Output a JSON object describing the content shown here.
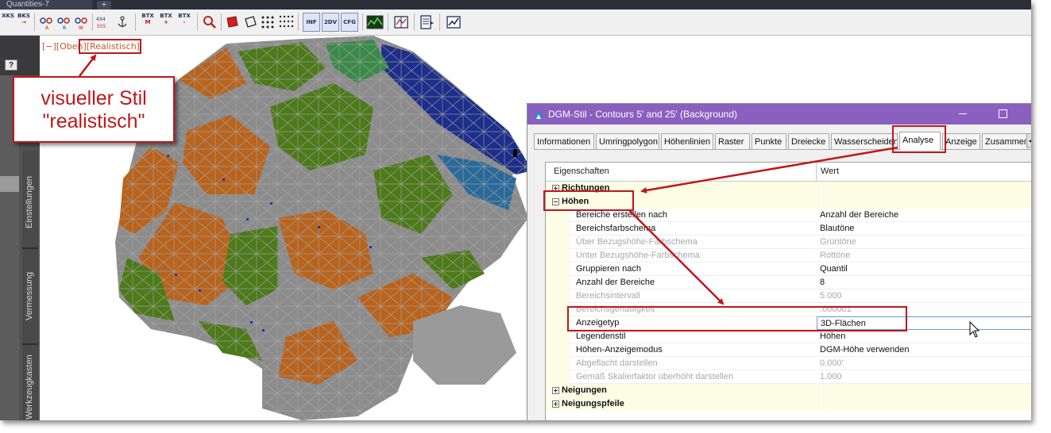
{
  "window": {
    "doc_tab": "Quantities-7",
    "new_tab": "+"
  },
  "toolbar": {
    "buttons": [
      {
        "name": "xks",
        "line1": "XKS",
        "line2": ""
      },
      {
        "name": "bks",
        "line1": "BKS",
        "line2": "→"
      },
      {
        "name": "btx-a",
        "line1": "BTX",
        "line2": "M"
      },
      {
        "name": "btx-b",
        "line1": "BTX",
        "line2": "+"
      },
      {
        "name": "btx-c",
        "line1": "BTX",
        "line2": "-"
      },
      {
        "name": "inf",
        "line1": "INF",
        "line2": ""
      },
      {
        "name": "2dv",
        "line1": "2DV",
        "line2": ""
      },
      {
        "name": "cfg",
        "line1": "CFG",
        "line2": ""
      }
    ]
  },
  "viewport": {
    "label_prefix": "[−][Oben]",
    "label_style": "[Realistisch]"
  },
  "palette": {
    "help_button": "?",
    "tabs": [
      "Einstellungen",
      "Vermessung",
      "Werkzeugkasten"
    ]
  },
  "callout": {
    "line1": "visueller Stil",
    "line2": "\"realistisch\""
  },
  "dialog": {
    "title": "DGM-Stil - Contours 5' and 25' (Background)",
    "tabs": [
      "Informationen",
      "Umringpolygon",
      "Höhenlinien",
      "Raster",
      "Punkte",
      "Dreiecke",
      "Wasserscheiden",
      "Analyse",
      "Anzeige",
      "Zusammenf"
    ],
    "active_tab": "Analyse",
    "grid": {
      "col_property": "Eigenschaften",
      "col_value": "Wert",
      "richtungen": "Richtungen",
      "hoehen": "Höhen",
      "rows": [
        {
          "label": "Bereiche erstellen nach",
          "value": "Anzahl der Bereiche",
          "dim": false
        },
        {
          "label": "Bereichsfarbschema",
          "value": "Blautöne",
          "dim": false
        },
        {
          "label": "Über Bezugshöhe-Farbschema",
          "value": "Grüntöne",
          "dim": true
        },
        {
          "label": "Unter Bezugshöhe-Farbschema",
          "value": "Rottöne",
          "dim": true
        },
        {
          "label": "Gruppieren nach",
          "value": "Quantil",
          "dim": false
        },
        {
          "label": "Anzahl der Bereiche",
          "value": "8",
          "dim": false
        },
        {
          "label": "Bereichsintervall",
          "value": "5.000",
          "dim": true
        },
        {
          "label": "Bereichsgenauigkeit",
          "value": ".000001",
          "dim": true
        },
        {
          "label": "Anzeigetyp",
          "value": "3D-Flächen",
          "dim": false
        },
        {
          "label": "Legendenstil",
          "value": "Höhen",
          "dim": false
        },
        {
          "label": "Höhen-Anzeigemodus",
          "value": "DGM-Höhe verwenden",
          "dim": false
        },
        {
          "label": "Abgeflacht darstellen",
          "value": "0.000'",
          "dim": true
        },
        {
          "label": "Gemäß Skalierfaktor überhöht darstellen",
          "value": "1.000",
          "dim": true
        }
      ],
      "neigungen": "Neigungen",
      "neigungspfeile": "Neigungspfeile"
    }
  },
  "colors": {
    "accent_red": "#c0171b",
    "dialog_title": "#8a5fbf",
    "terrain_green": "#4d7a1a",
    "terrain_orange": "#b8641e",
    "terrain_blue": "#1d2f8a",
    "terrain_mesh": "#8c8c8c"
  }
}
